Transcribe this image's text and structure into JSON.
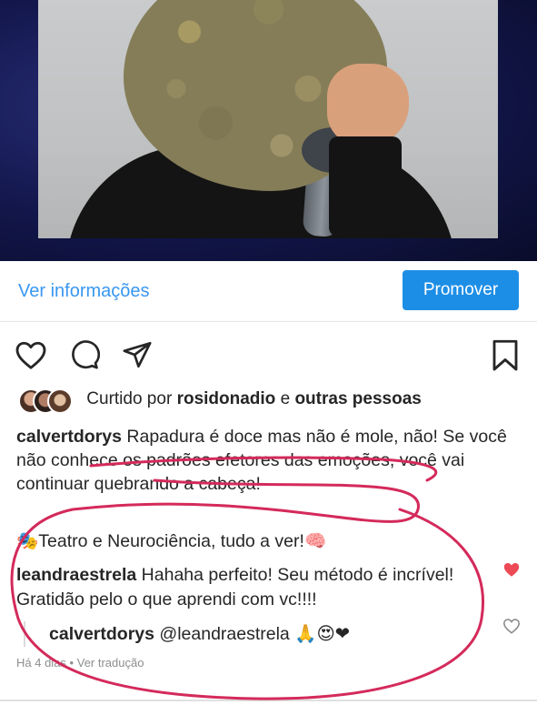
{
  "post": {
    "info_link": "Ver informações",
    "promote_button": "Promover",
    "liked_by_prefix": "Curtido por",
    "liked_by_user": "rosidonadio",
    "liked_by_connector": "e",
    "liked_by_others": "outras pessoas",
    "caption_user": "calvertdorys",
    "caption_text": "Rapadura é doce mas não é mole, não! Se você não conhece os padrões efetores das emoções, você vai continuar quebrando a cabeça!",
    "caption_extra": "Teatro e Neurociência, tudo a ver!",
    "caption_extra_emoji_start": "🎭",
    "caption_extra_emoji_end": "🧠"
  },
  "comments": [
    {
      "user": "leandraestrela",
      "text": "Hahaha perfeito! Seu método é incrível! Gratidão pelo o que aprendi com vc!!!!",
      "liked": true
    }
  ],
  "reply": {
    "user": "calvertdorys",
    "text": "@leandraestrela",
    "emojis": "🙏😍❤",
    "liked": false
  },
  "meta": {
    "time_ago": "Há 4 dias",
    "separator": "•",
    "translate_link": "Ver tradução"
  },
  "icons": {
    "like": "heart-outline",
    "comment": "speech-bubble",
    "share": "paper-plane",
    "save": "bookmark"
  },
  "colors": {
    "link_blue": "#3897f0",
    "button_blue": "#1d8ee6",
    "heart_red": "#ed4956",
    "scribble_pink": "#d42a5b"
  }
}
